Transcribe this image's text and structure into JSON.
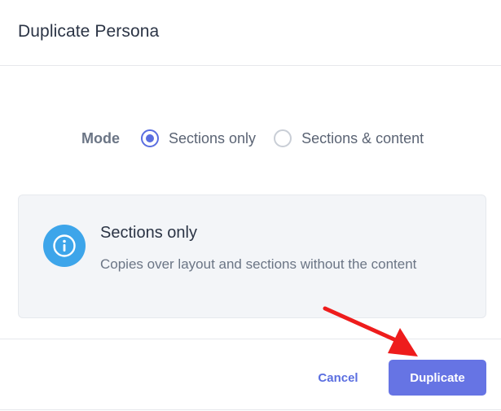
{
  "dialog": {
    "title": "Duplicate Persona"
  },
  "mode": {
    "label": "Mode",
    "options": [
      {
        "label": "Sections only",
        "selected": true
      },
      {
        "label": "Sections & content",
        "selected": false
      }
    ]
  },
  "info": {
    "icon": "info-icon",
    "title": "Sections only",
    "description": "Copies over layout and sections without the content"
  },
  "actions": {
    "cancel_label": "Cancel",
    "duplicate_label": "Duplicate"
  },
  "colors": {
    "accent": "#6674e4",
    "info_icon": "#3da5ea",
    "annotation_arrow": "#ee1c1c"
  }
}
